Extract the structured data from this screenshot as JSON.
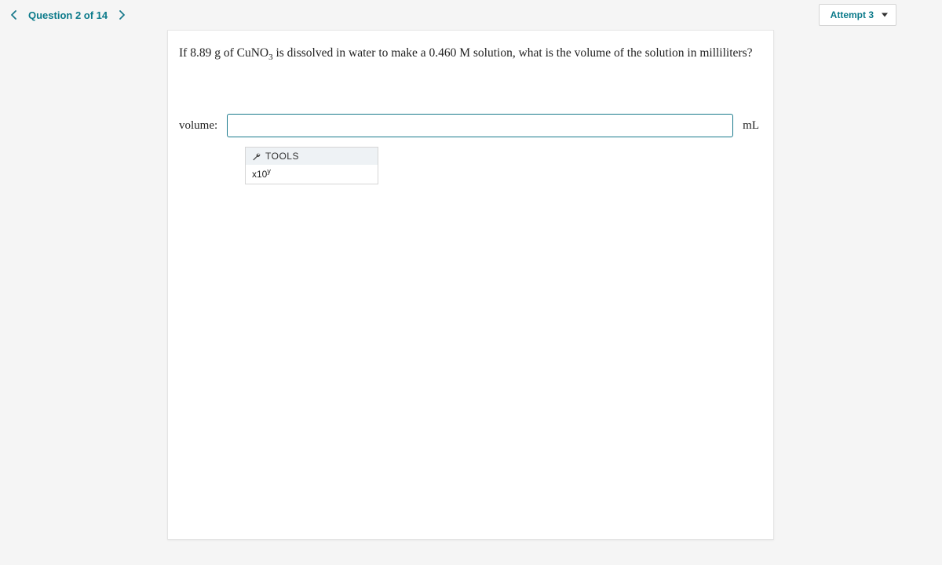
{
  "header": {
    "question_label": "Question 2 of 14",
    "attempt_label": "Attempt 3"
  },
  "question": {
    "prefix": "If 8.89 g of CuNO",
    "sub": "3",
    "suffix": " is dissolved in water to make a 0.460 M solution, what is the volume of the solution in milliliters?"
  },
  "answer": {
    "label": "volume:",
    "value": "",
    "unit": "mL"
  },
  "tools": {
    "header": "TOOLS",
    "item_prefix": "x10",
    "item_sup": "y"
  }
}
